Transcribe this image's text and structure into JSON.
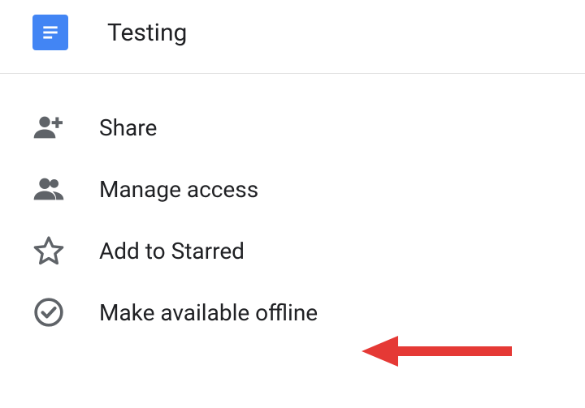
{
  "doc": {
    "title": "Testing",
    "icon_name": "google-doc-icon"
  },
  "menu": {
    "items": [
      {
        "icon": "person-add-icon",
        "label": "Share"
      },
      {
        "icon": "people-icon",
        "label": "Manage access"
      },
      {
        "icon": "star-outline-icon",
        "label": "Add to Starred"
      },
      {
        "icon": "offline-check-icon",
        "label": "Make available offline"
      }
    ]
  },
  "annotation": {
    "kind": "arrow",
    "color": "#e53935"
  }
}
